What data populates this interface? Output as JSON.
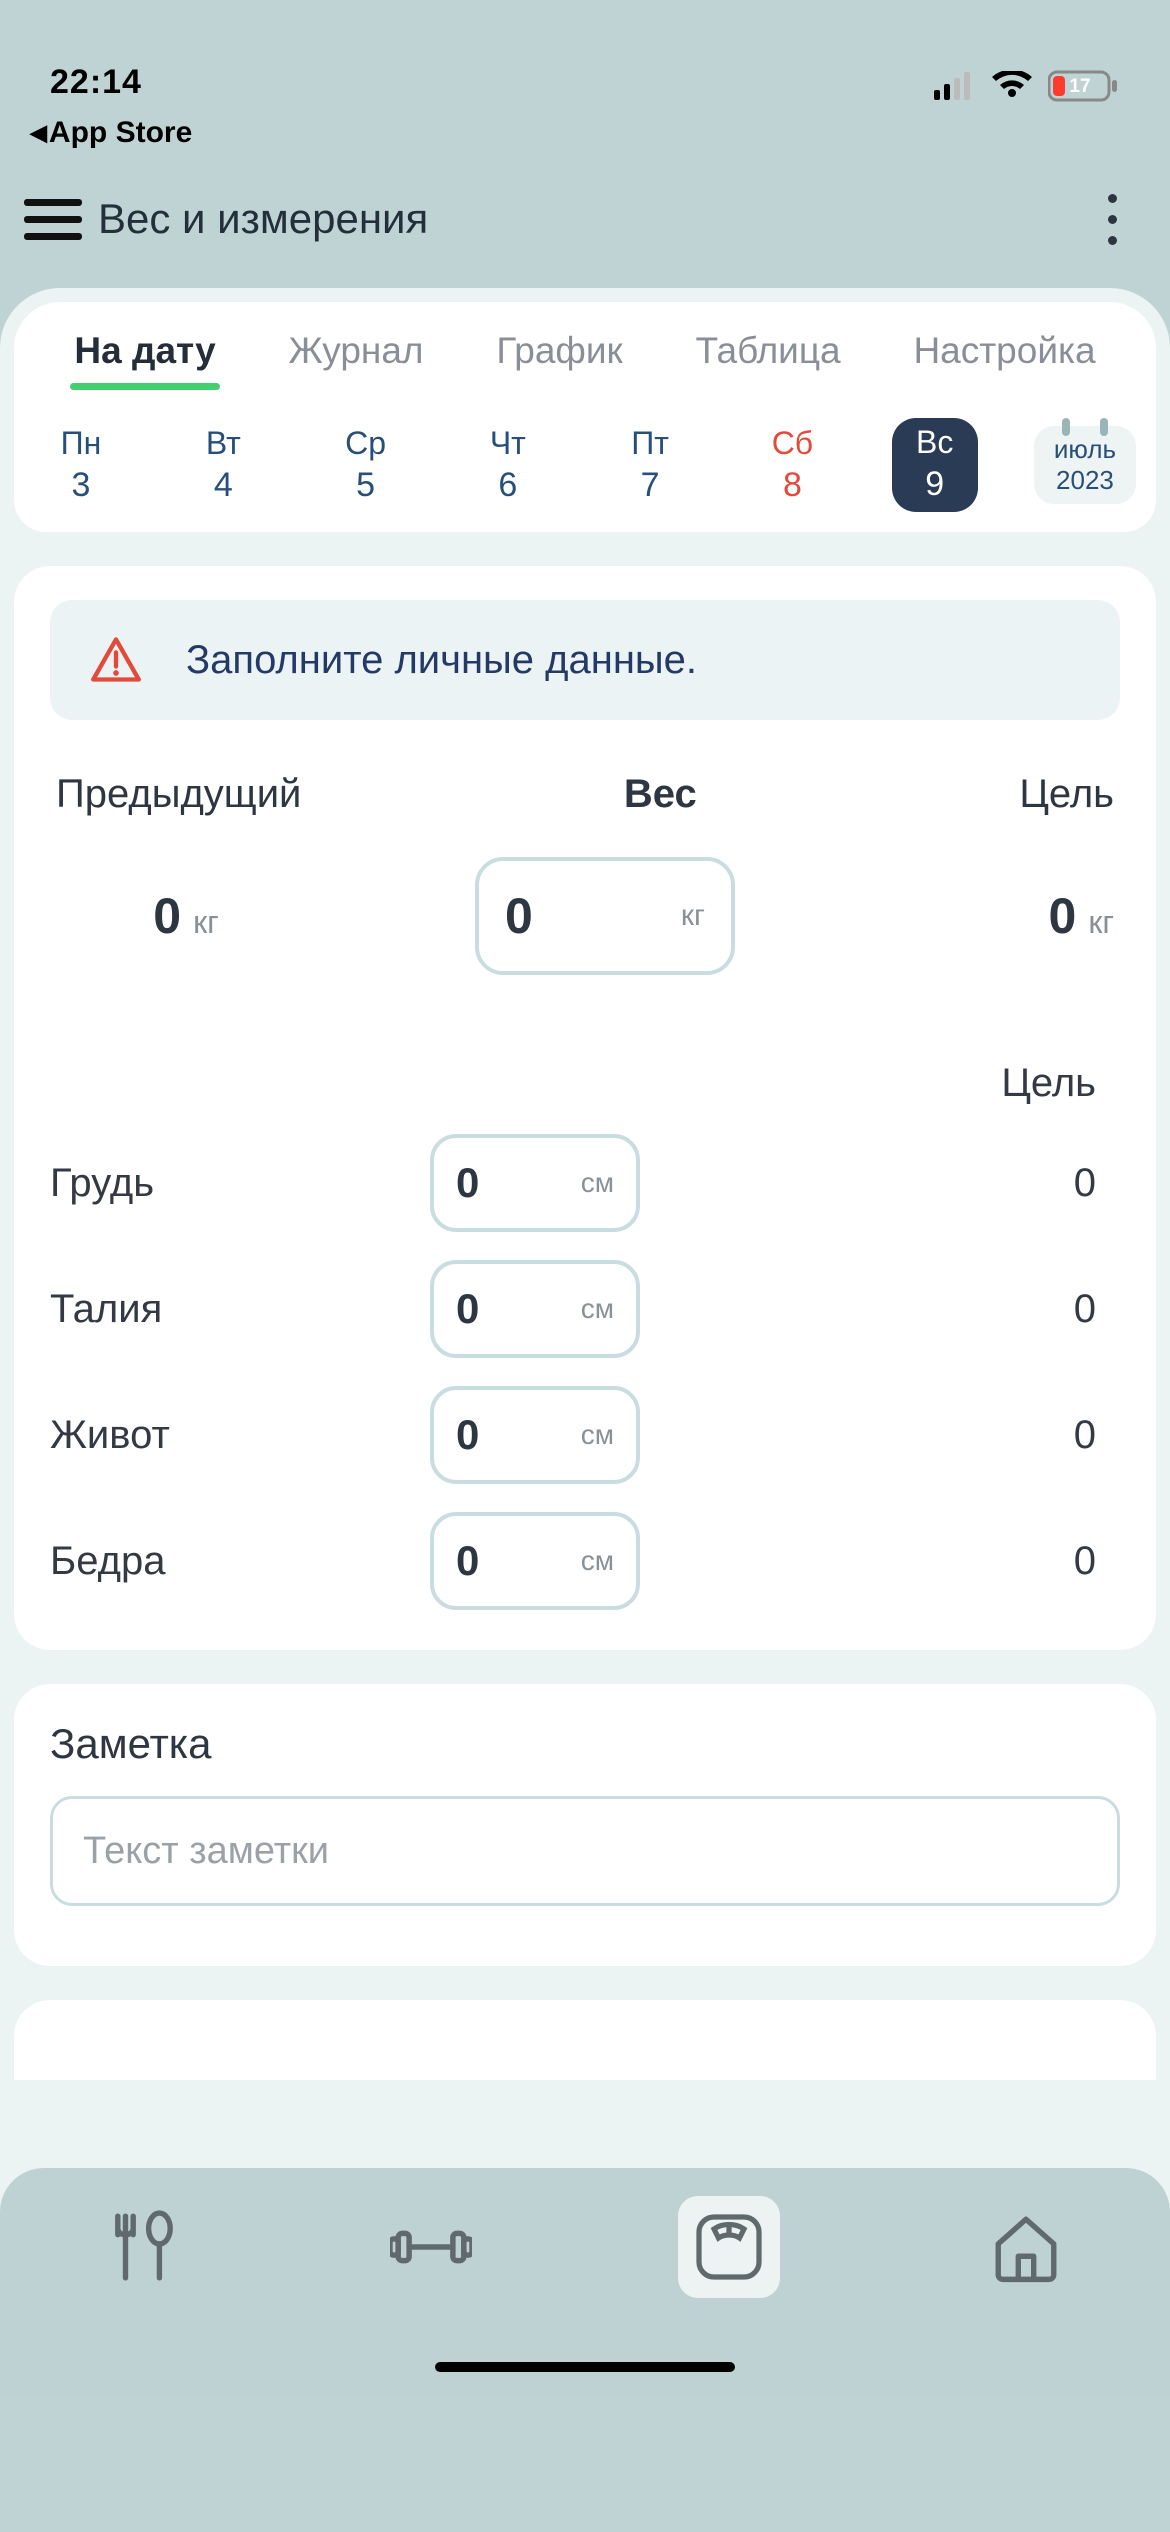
{
  "status": {
    "time": "22:14",
    "battery": "17",
    "back_label": "App Store"
  },
  "header": {
    "title": "Вес и измерения"
  },
  "tabs": [
    "На дату",
    "Журнал",
    "График",
    "Таблица",
    "Настройка"
  ],
  "days": [
    {
      "dow": "Пн",
      "num": "3"
    },
    {
      "dow": "Вт",
      "num": "4"
    },
    {
      "dow": "Ср",
      "num": "5"
    },
    {
      "dow": "Чт",
      "num": "6"
    },
    {
      "dow": "Пт",
      "num": "7"
    },
    {
      "dow": "Сб",
      "num": "8"
    },
    {
      "dow": "Вс",
      "num": "9"
    }
  ],
  "month": {
    "label": "июль",
    "year": "2023"
  },
  "banner": {
    "text": "Заполните личные данные."
  },
  "weight": {
    "prev_label": "Предыдущий",
    "cur_label": "Вес",
    "goal_label": "Цель",
    "prev_val": "0",
    "prev_unit": "кг",
    "cur_val": "0",
    "cur_unit": "кг",
    "goal_val": "0",
    "goal_unit": "кг"
  },
  "meas_goal_header": "Цель",
  "measurements": [
    {
      "label": "Грудь",
      "val": "0",
      "unit": "см",
      "goal": "0"
    },
    {
      "label": "Талия",
      "val": "0",
      "unit": "см",
      "goal": "0"
    },
    {
      "label": "Живот",
      "val": "0",
      "unit": "см",
      "goal": "0"
    },
    {
      "label": "Бедра",
      "val": "0",
      "unit": "см",
      "goal": "0"
    }
  ],
  "note": {
    "title": "Заметка",
    "placeholder": "Текст заметки"
  }
}
